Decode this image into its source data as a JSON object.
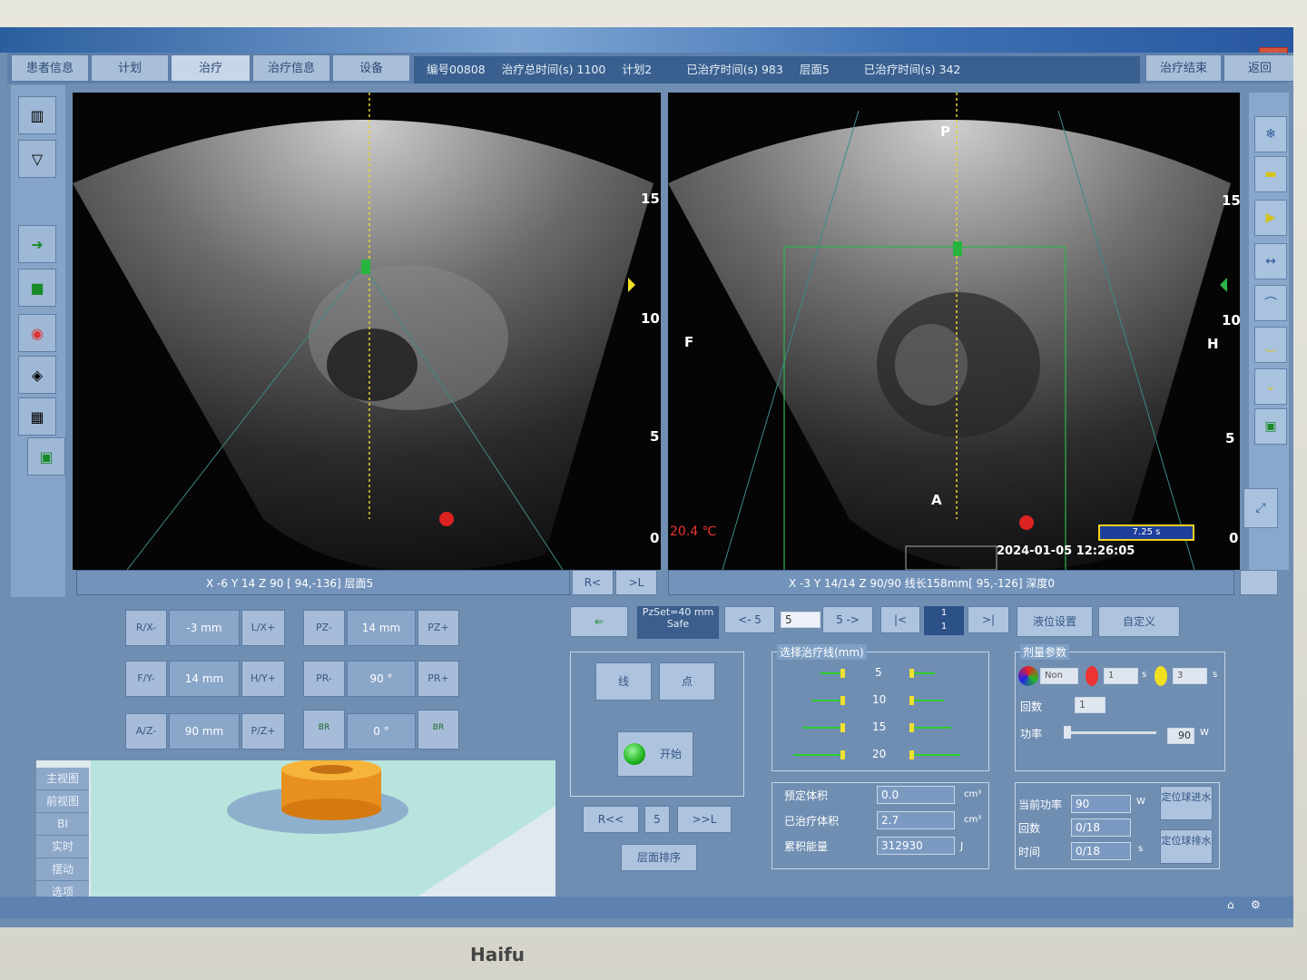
{
  "window": {
    "close": "×"
  },
  "nav_tabs": [
    "患者信息",
    "计划",
    "治疗",
    "治疗信息",
    "设备"
  ],
  "info": {
    "id": "编号00808",
    "total_time": "治疗总时间(s) 1100",
    "plan": "计划2",
    "treated_time": "已治疗时间(s) 983",
    "layer": "层面5",
    "treated_time2": "已治疗时间(s) 342"
  },
  "top_buttons": {
    "end": "治疗结束",
    "back": "返回"
  },
  "left_view": {
    "scale_marks": [
      "15",
      "10",
      "5",
      "0"
    ],
    "status": "X -6  Y 14  Z 90  [ 94,-136] 层面5",
    "btn_r": "R<",
    "btn_l": ">L"
  },
  "right_view": {
    "labels": {
      "P": "P",
      "F": "F",
      "H": "H",
      "A": "A"
    },
    "scale_marks": [
      "15",
      "10",
      "5",
      "0"
    ],
    "temperature": "20.4 ℃",
    "timer": "7.25 s",
    "datetime": "2024-01-05 12:26:05",
    "status": "X -3  Y 14/14 Z  90/90 线长158mm[  95,-126] 深度0"
  },
  "position_controls": {
    "rx_minus": "R/X-",
    "rx_val": "-3 mm",
    "lx_plus": "L/X+",
    "pz_minus": "PZ-",
    "pz_val": "14 mm",
    "pz_plus": "PZ+",
    "fy_minus": "F/Y-",
    "fy_val": "14 mm",
    "hy_plus": "H/Y+",
    "pr_minus": "PR-",
    "pr_val": "90 °",
    "pr_plus": "PR+",
    "az_minus": "A/Z-",
    "az_val": "90 mm",
    "pz2_plus": "P/Z+",
    "br1": "BR",
    "br_val": "0 °",
    "br2": "BR"
  },
  "view_list": [
    "主视图",
    "前视图",
    "BI",
    "实时",
    "摆动",
    "选项"
  ],
  "toolbar": {
    "pzset": "PzSet=40 mm",
    "safe": "Safe",
    "prev5": "<- 5",
    "step_val": "5",
    "next5": "5 ->",
    "first": "|<",
    "counter_top": "1",
    "counter_bottom": "1",
    "last": ">|",
    "liquid": "液位设置",
    "custom": "自定义"
  },
  "mode": {
    "line": "线",
    "point": "点",
    "start": "开始"
  },
  "layer_nav": {
    "rr": "R<<",
    "val": "5",
    "ll": ">>L",
    "sort": "层面排序"
  },
  "line_select": {
    "title": "选择治疗线(mm)",
    "values": [
      "5",
      "10",
      "15",
      "20"
    ]
  },
  "dose": {
    "title": "剂量参数",
    "mode": "Non",
    "v1": "1",
    "v2": "3",
    "unit_s": "s",
    "count_label": "回数",
    "count_val": "1",
    "power_label": "功率",
    "power_val": "90",
    "power_unit": "W"
  },
  "volumes": {
    "planned_label": "预定体积",
    "planned_val": "0.0",
    "planned_unit": "cm³",
    "treated_label": "已治疗体积",
    "treated_val": "2.7",
    "treated_unit": "cm³",
    "energy_label": "累积能量",
    "energy_val": "312930",
    "energy_unit": "J"
  },
  "current": {
    "power_label": "当前功率",
    "power_val": "90",
    "power_unit": "W",
    "count_label": "回数",
    "count_val": "0/18",
    "time_label": "时间",
    "time_val": "0/18",
    "time_unit": "s"
  },
  "ball": {
    "fill": "定位球进水",
    "drain": "定位球排水"
  },
  "brand": "Haifu"
}
